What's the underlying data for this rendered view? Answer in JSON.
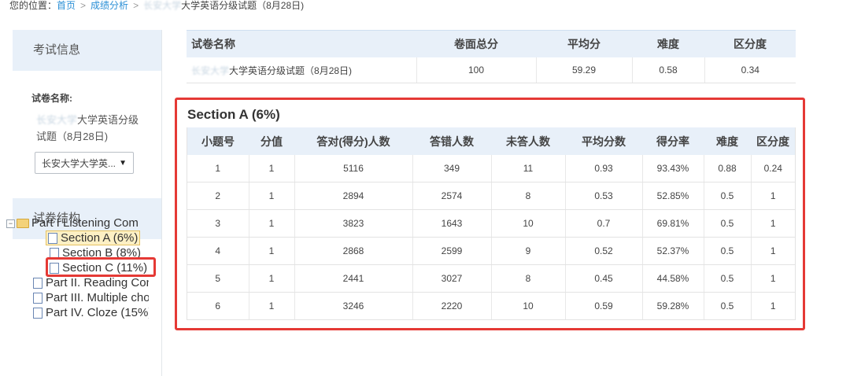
{
  "breadcrumb": {
    "prefix": "您的位置：",
    "home": "首页",
    "sep1": ">",
    "analysis": "成绩分析",
    "sep2": ">",
    "current_blur": "长安大学",
    "current": "大学英语分级试题（8月28日)"
  },
  "left_panel": {
    "exam_info_title": "考试信息",
    "paper_name_label": "试卷名称:",
    "paper_name_blur": "长安大学",
    "paper_name_line1": "大学英语分级",
    "paper_name_line2": "试题（8月28日)",
    "select_value": "长安大学大学英...",
    "structure_title": "试卷结构",
    "tree": [
      {
        "label": "Part I Listening Com",
        "expanded_symbol": "−"
      },
      {
        "label": "Section A (6%)"
      },
      {
        "label": "Section B (8%)"
      },
      {
        "label": "Section C (11%)"
      },
      {
        "label": "Part II. Reading Con"
      },
      {
        "label": "Part III. Multiple cho"
      },
      {
        "label": "Part IV. Cloze (15%)"
      }
    ]
  },
  "summary": {
    "headers": [
      "试卷名称",
      "卷面总分",
      "平均分",
      "难度",
      "区分度"
    ],
    "name_blur": "长安大学",
    "name": "大学英语分级试题（8月28日)",
    "total": "100",
    "average": "59.29",
    "difficulty": "0.58",
    "discrimination": "0.34"
  },
  "section": {
    "title": "Section A (6%)",
    "headers": [
      "小题号",
      "分值",
      "答对(得分)人数",
      "答错人数",
      "未答人数",
      "平均分数",
      "得分率",
      "难度",
      "区分度"
    ],
    "rows": [
      [
        "1",
        "1",
        "5116",
        "349",
        "11",
        "0.93",
        "93.43%",
        "0.88",
        "0.24"
      ],
      [
        "2",
        "1",
        "2894",
        "2574",
        "8",
        "0.53",
        "52.85%",
        "0.5",
        "1"
      ],
      [
        "3",
        "1",
        "3823",
        "1643",
        "10",
        "0.7",
        "69.81%",
        "0.5",
        "1"
      ],
      [
        "4",
        "1",
        "2868",
        "2599",
        "9",
        "0.52",
        "52.37%",
        "0.5",
        "1"
      ],
      [
        "5",
        "1",
        "2441",
        "3027",
        "8",
        "0.45",
        "44.58%",
        "0.5",
        "1"
      ],
      [
        "6",
        "1",
        "3246",
        "2220",
        "10",
        "0.59",
        "59.28%",
        "0.5",
        "1"
      ]
    ]
  },
  "colors": {
    "accent_link": "#2a8fd6",
    "header_bg": "#e8f0f9",
    "highlight_border": "#e53935"
  }
}
